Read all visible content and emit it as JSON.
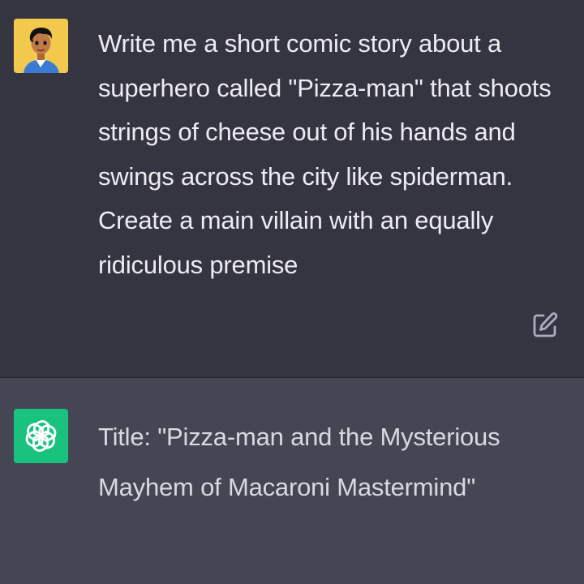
{
  "conversation": {
    "user_message": {
      "avatar_icon": "user-avatar-icon",
      "text": "Write me a short comic story about a superhero called \"Pizza-man\" that shoots strings of cheese out of his hands and swings across the city like spiderman. Create a main villain with an equally ridiculous premise",
      "edit_icon": "edit-icon"
    },
    "assistant_message": {
      "avatar_icon": "openai-logo-icon",
      "text": "Title: \"Pizza-man and the Mysterious Mayhem of Macaroni Mastermind\""
    }
  },
  "colors": {
    "user_bg": "#343541",
    "assistant_bg": "#444654",
    "assistant_avatar": "#19c37d",
    "user_avatar_bg": "#f2c94c"
  }
}
